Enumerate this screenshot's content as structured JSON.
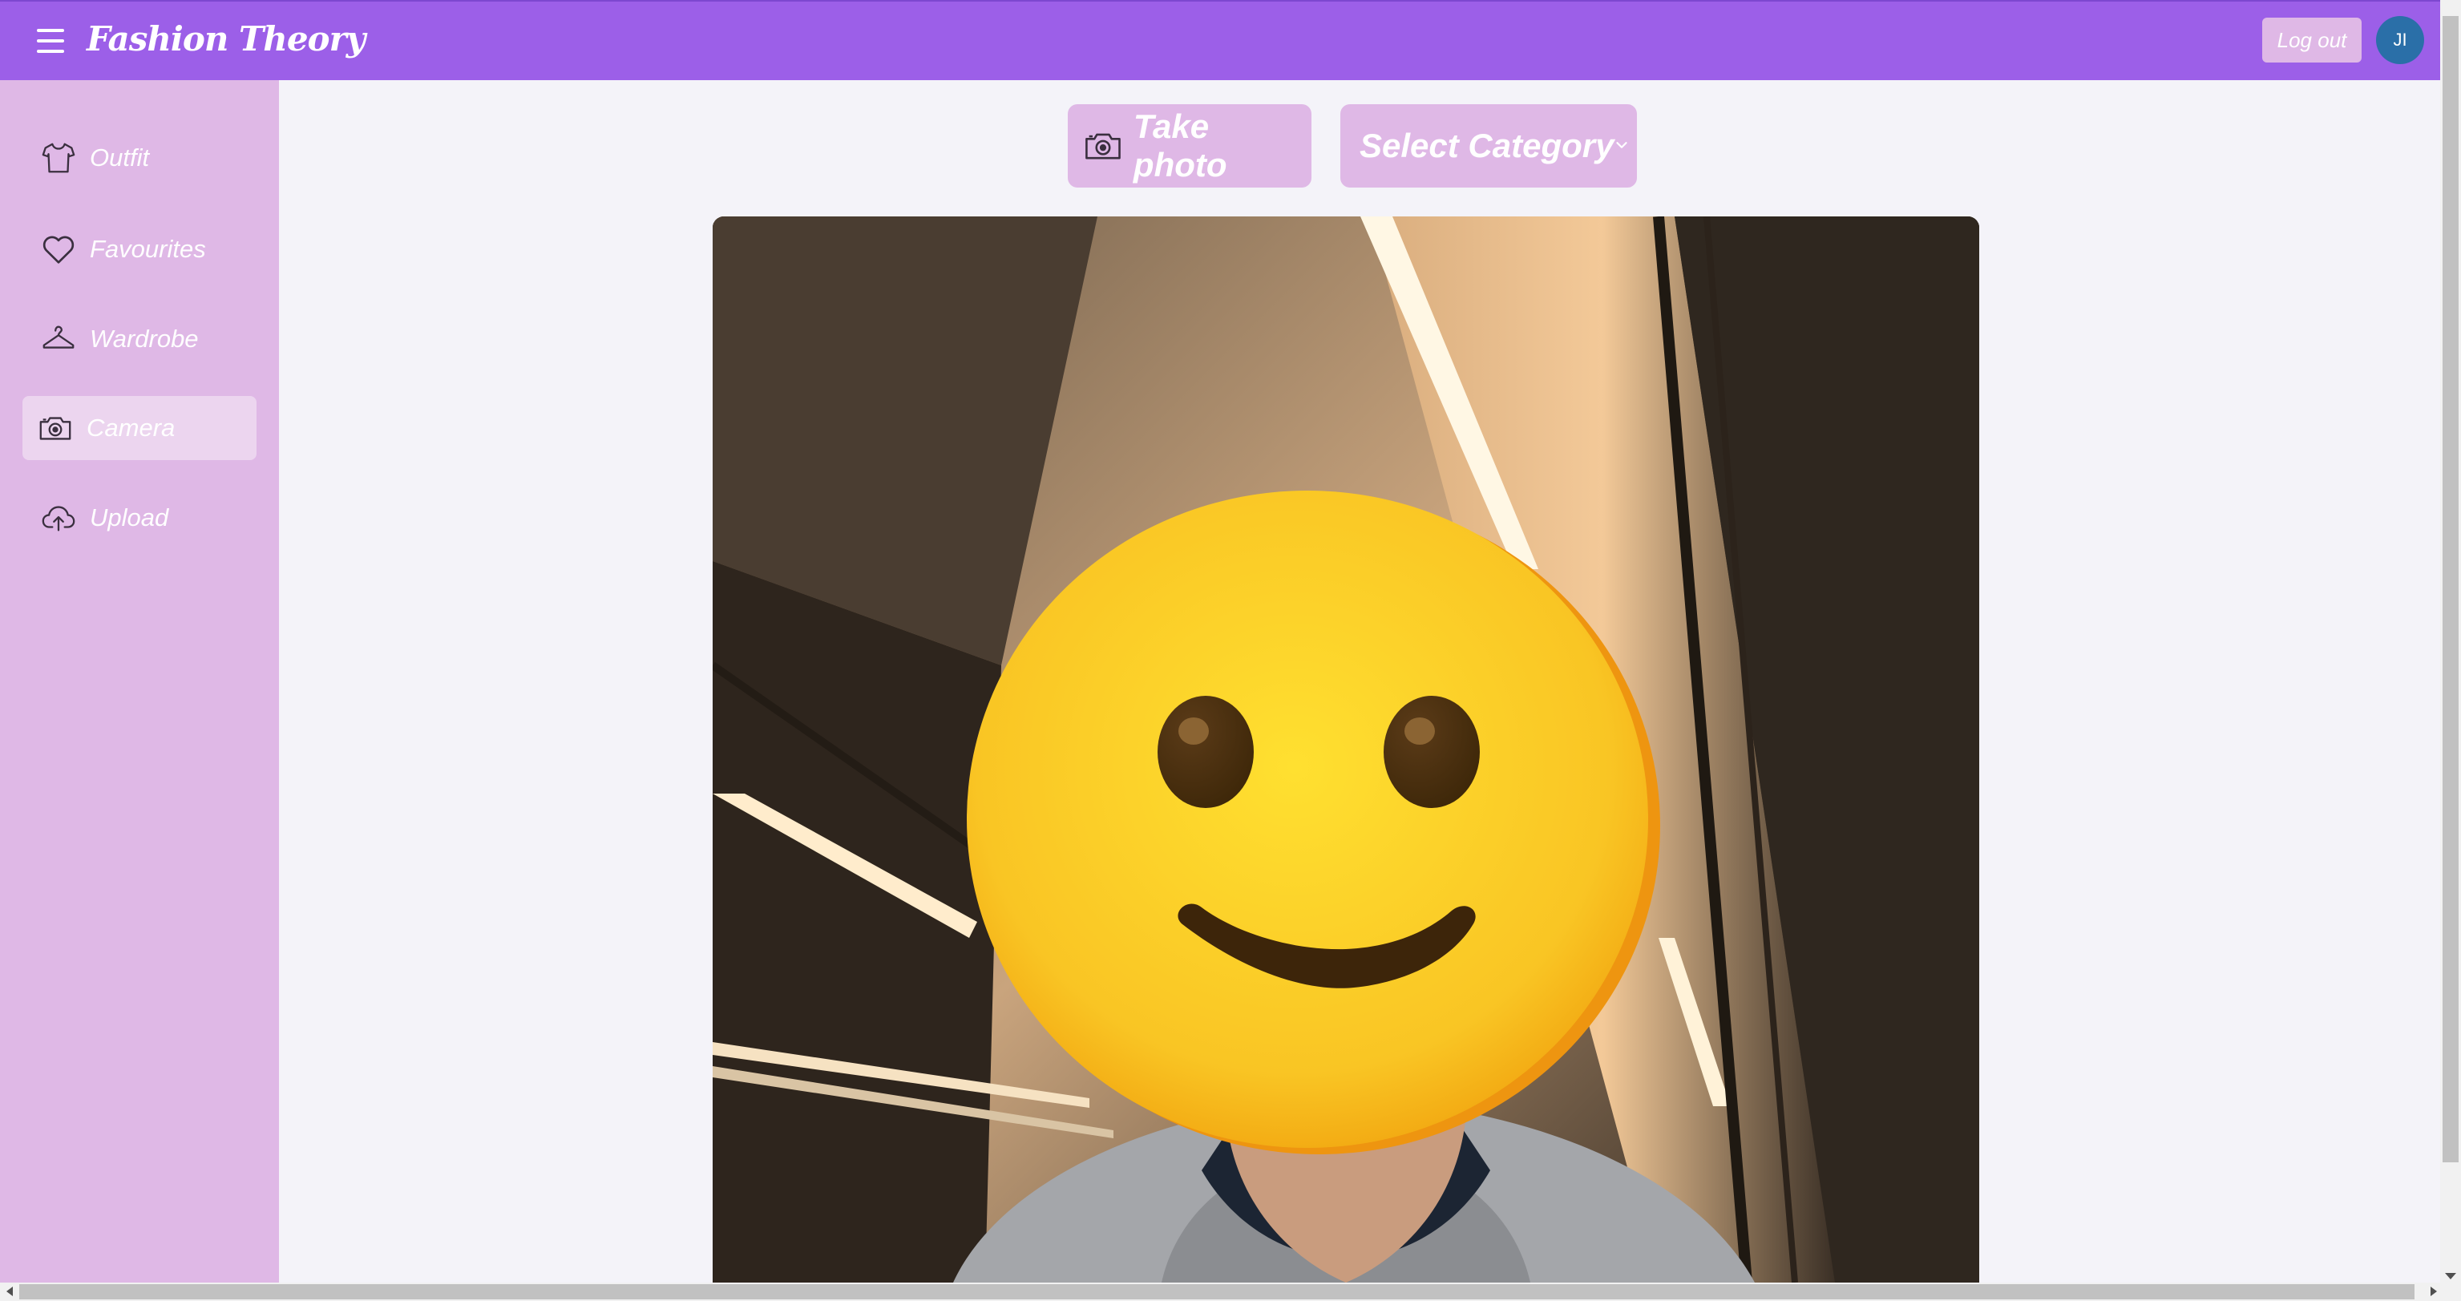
{
  "app": {
    "brand": "Fashion Theory"
  },
  "header": {
    "logout_label": "Log out",
    "avatar_initials": "JI"
  },
  "sidebar": {
    "items": [
      {
        "label": "Outfit",
        "icon": "shirt-icon"
      },
      {
        "label": "Favourites",
        "icon": "heart-icon"
      },
      {
        "label": "Wardrobe",
        "icon": "hanger-icon"
      },
      {
        "label": "Camera",
        "icon": "camera-icon",
        "active": true
      },
      {
        "label": "Upload",
        "icon": "cloud-upload-icon"
      }
    ]
  },
  "toolbar": {
    "take_photo_label": "Take photo",
    "category_selected": "Select Category"
  },
  "colors": {
    "header_bg": "#9c5fe8",
    "sidebar_bg": "#dfb8e6",
    "active_item_bg": "#ecd5ef",
    "avatar_bg": "#2a6fa8",
    "page_bg": "#f4f3f9"
  }
}
